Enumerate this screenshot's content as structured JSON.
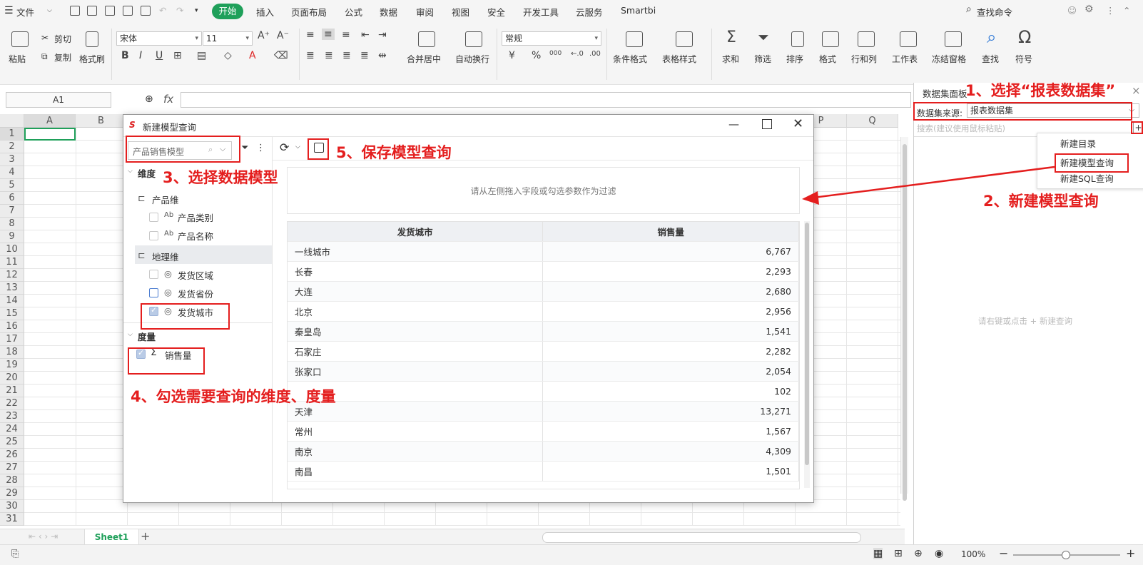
{
  "menubar": {
    "file": "文件",
    "tabs": [
      "开始",
      "插入",
      "页面布局",
      "公式",
      "数据",
      "审阅",
      "视图",
      "安全",
      "开发工具",
      "云服务",
      "Smartbi"
    ],
    "search": "查找命令"
  },
  "ribbon": {
    "paste": "粘贴",
    "cut": "剪切",
    "copy": "复制",
    "format_painter": "格式刷",
    "font_name": "宋体",
    "font_size": "11",
    "merge": "合并居中",
    "wrap": "自动换行",
    "number_format": "常规",
    "cond_format": "条件格式",
    "table_style": "表格样式",
    "sum": "求和",
    "filter": "筛选",
    "sort": "排序",
    "format": "格式",
    "rows_cols": "行和列",
    "worksheet": "工作表",
    "freeze": "冻结窗格",
    "find": "查找",
    "symbol": "符号",
    "bold": "B",
    "italic": "I",
    "underline": "U",
    "font_color": "A",
    "percent": "%",
    "thousands": "000",
    "yuan": "¥"
  },
  "formula": {
    "cell_ref": "A1",
    "fx": "fx"
  },
  "grid": {
    "columns": [
      "A",
      "B",
      "P",
      "Q"
    ],
    "rows": [
      "1",
      "2",
      "3",
      "4",
      "5",
      "6",
      "7",
      "8",
      "9",
      "10",
      "11",
      "12",
      "13",
      "14",
      "15",
      "16",
      "17",
      "18",
      "19",
      "20",
      "21",
      "22",
      "23",
      "24",
      "25",
      "26",
      "27",
      "28",
      "29",
      "30",
      "31"
    ]
  },
  "sheet": {
    "tab": "Sheet1",
    "add": "+"
  },
  "status": {
    "zoom": "100%"
  },
  "dialog": {
    "title": "新建模型查询",
    "model": "产品销售模型",
    "dimension_label": "维度",
    "product_dim": "产品维",
    "product_category": "产品类别",
    "product_name": "产品名称",
    "geo_dim": "地理维",
    "ship_region": "发货区域",
    "ship_province": "发货省份",
    "ship_city": "发货城市",
    "measure_label": "度量",
    "sales": "销售量",
    "filter_hint": "请从左侧拖入字段或勾选参数作为过滤",
    "table": {
      "headers": [
        "发货城市",
        "销售量"
      ],
      "rows": [
        [
          "一线城市",
          "6,767"
        ],
        [
          "长春",
          "2,293"
        ],
        [
          "大连",
          "2,680"
        ],
        [
          "北京",
          "2,956"
        ],
        [
          "秦皇岛",
          "1,541"
        ],
        [
          "石家庄",
          "2,282"
        ],
        [
          "张家口",
          "2,054"
        ],
        [
          "",
          "102"
        ],
        [
          "天津",
          "13,271"
        ],
        [
          "常州",
          "1,567"
        ],
        [
          "南京",
          "4,309"
        ],
        [
          "南昌",
          "1,501"
        ]
      ]
    }
  },
  "dspanel": {
    "title": "数据集面板",
    "source_label": "数据集来源:",
    "source_value": "报表数据集",
    "search_placeholder": "搜索(建议使用鼠标粘贴)",
    "menu": [
      "新建目录",
      "新建模型查询",
      "新建SQL查询"
    ],
    "empty_hint": "请右键或点击 + 新建查询"
  },
  "annotations": {
    "a1": "1、选择“报表数据集”",
    "a2": "2、新建模型查询",
    "a3": "3、选择数据模型",
    "a4": "4、勾选需要查询的维度、度量",
    "a5": "5、保存模型查询"
  }
}
